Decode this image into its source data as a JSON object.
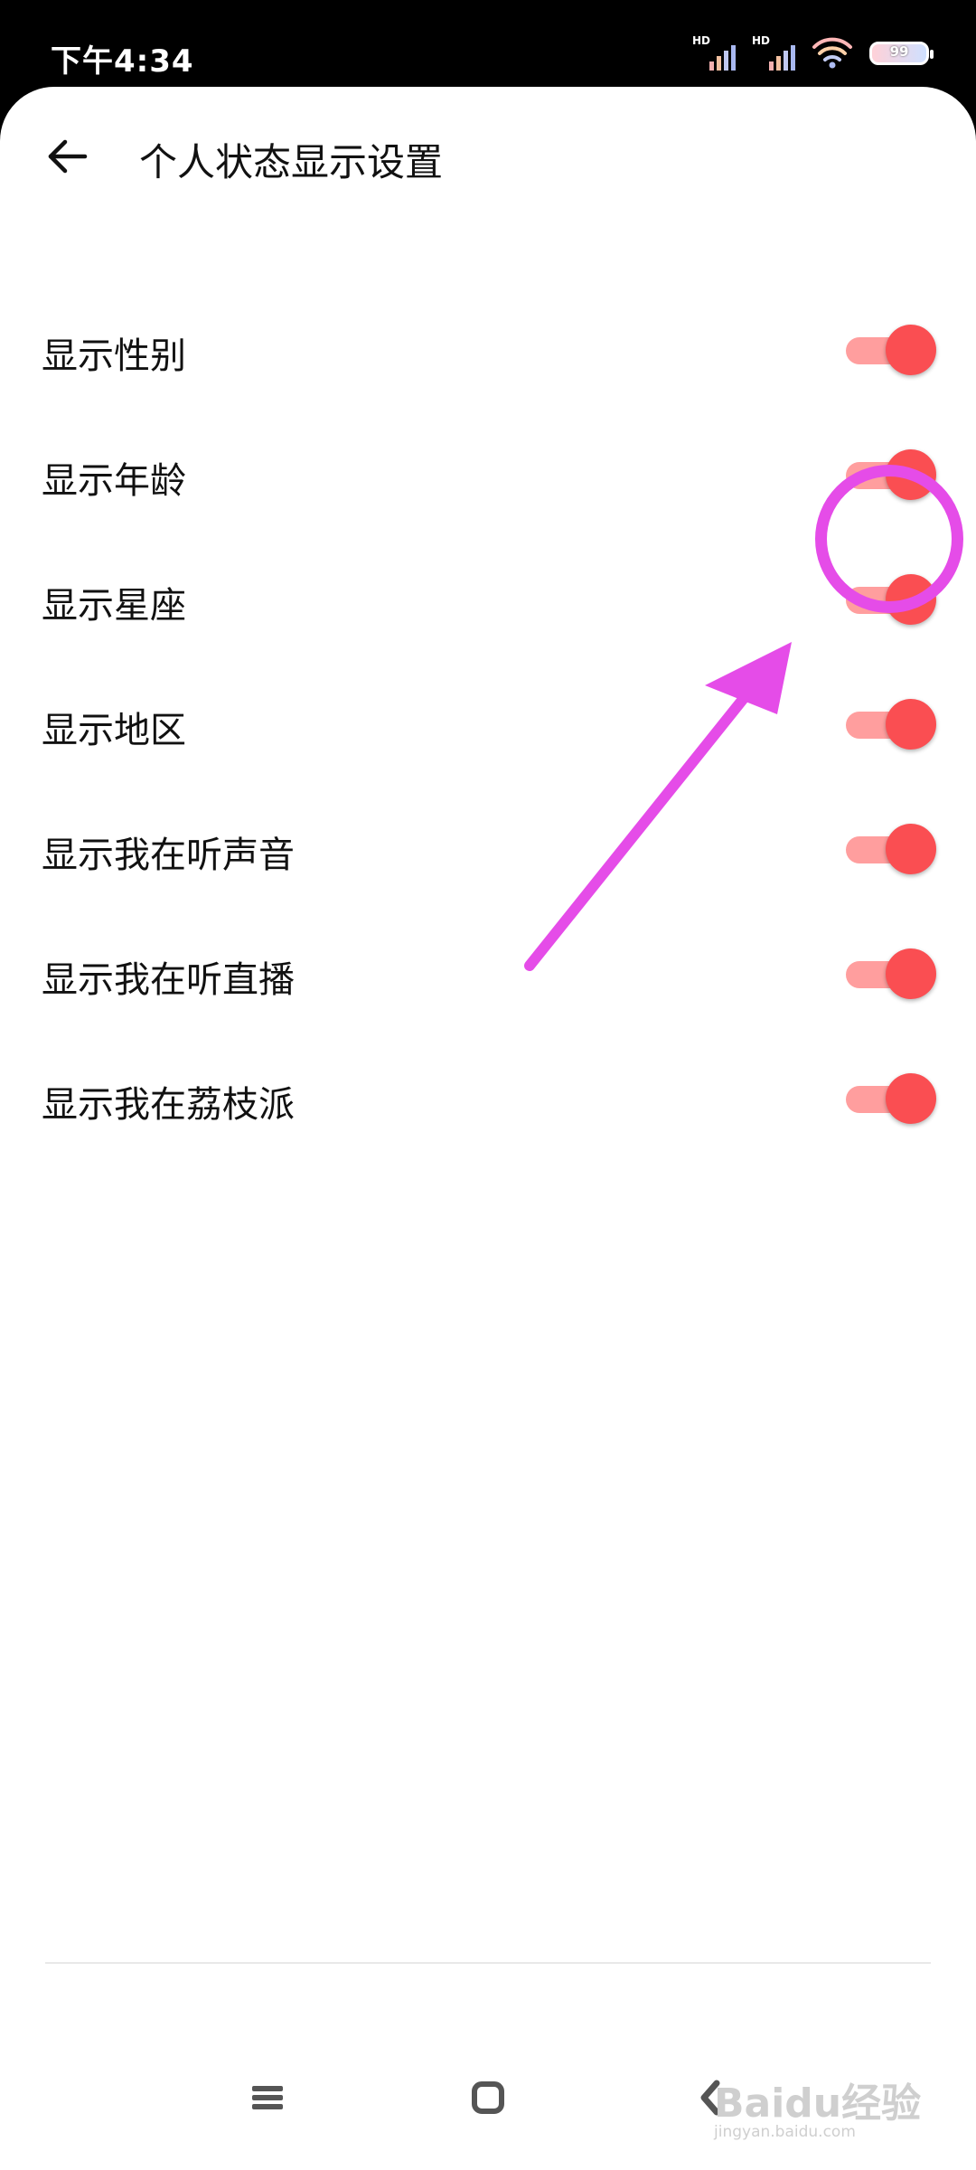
{
  "status_bar": {
    "time": "下午4:34",
    "signal_1_label": "HD",
    "signal_2_label": "HD",
    "battery_level": "99"
  },
  "header": {
    "title": "个人状态显示设置"
  },
  "settings": [
    {
      "label": "显示性别",
      "enabled": true
    },
    {
      "label": "显示年龄",
      "enabled": true
    },
    {
      "label": "显示星座",
      "enabled": true
    },
    {
      "label": "显示地区",
      "enabled": true
    },
    {
      "label": "显示我在听声音",
      "enabled": true
    },
    {
      "label": "显示我在听直播",
      "enabled": true
    },
    {
      "label": "显示我在荔枝派",
      "enabled": true
    }
  ],
  "colors": {
    "toggle_thumb": "#fa4e52",
    "toggle_track": "#ff9e9e",
    "annotation": "#e54ce8"
  },
  "watermark": {
    "brand": "Baidu经验",
    "domain": "jingyan.baidu.com"
  }
}
